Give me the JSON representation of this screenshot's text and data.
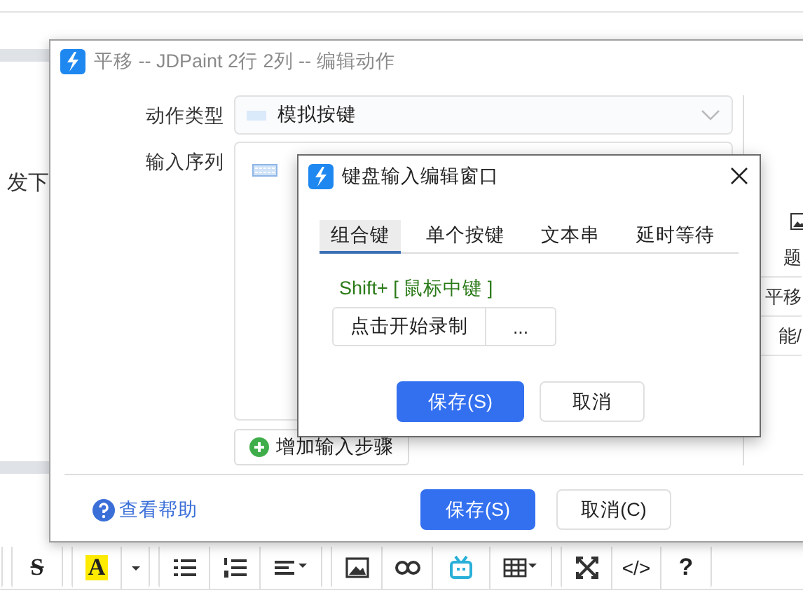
{
  "background_page": {
    "text": "发下",
    "toolbar": [
      [
        {
          "kind": "strike",
          "text": "S"
        }
      ],
      [
        {
          "kind": "highlight",
          "text": "A"
        },
        {
          "kind": "dropdown"
        }
      ],
      [
        {
          "kind": "bullets"
        },
        {
          "kind": "numbers"
        },
        {
          "kind": "align"
        }
      ],
      [
        {
          "kind": "image"
        },
        {
          "kind": "link"
        },
        {
          "kind": "tv"
        },
        {
          "kind": "table"
        }
      ],
      [
        {
          "kind": "fullscreen"
        },
        {
          "kind": "code",
          "text": "</>"
        },
        {
          "kind": "help",
          "text": "?"
        }
      ]
    ]
  },
  "edit_dialog": {
    "title": "平移 -- JDPaint 2行 2列 -- 编辑动作",
    "action_type": {
      "label": "动作类型",
      "value": "模拟按键"
    },
    "input_sequence": {
      "label": "输入序列"
    },
    "add_step_button": "增加输入步骤",
    "side_panel": [
      "题",
      "平移",
      "能/"
    ],
    "help_link": "查看帮助",
    "save_button": "保存(S)",
    "cancel_button": "取消(C)"
  },
  "keyboard_dialog": {
    "title": "键盘输入编辑窗口",
    "tabs": [
      {
        "label": "组合键",
        "selected": true
      },
      {
        "label": "单个按键",
        "selected": false
      },
      {
        "label": "文本串",
        "selected": false
      },
      {
        "label": "延时等待",
        "selected": false
      }
    ],
    "combo": "Shift+ [ 鼠标中键 ]",
    "record_button": "点击开始录制",
    "more_button": "...",
    "save_button": "保存(S)",
    "cancel_button": "取消"
  }
}
